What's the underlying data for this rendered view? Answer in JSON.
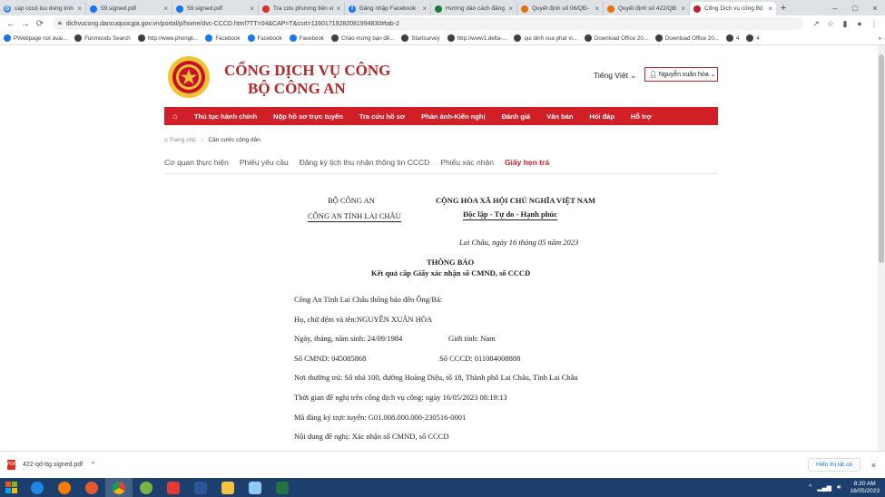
{
  "browser": {
    "tabs": [
      {
        "label": "cap cccd luu dong tinh",
        "favicon": "G",
        "color": "#4285f4"
      },
      {
        "label": "59.signed.pdf",
        "favicon": "",
        "color": "#1a73e8"
      },
      {
        "label": "59.signed.pdf",
        "favicon": "",
        "color": "#1a73e8"
      },
      {
        "label": "Tra cứu phương tiện vi",
        "favicon": "",
        "color": "#d93025"
      },
      {
        "label": "Đăng nhập Facebook",
        "favicon": "f",
        "color": "#1877f2"
      },
      {
        "label": "Hướng dẫn cách đăng",
        "favicon": "",
        "color": "#188038"
      },
      {
        "label": "Quyết định số 06/QĐ-",
        "favicon": "",
        "color": "#e8710a"
      },
      {
        "label": "Quyết định số 422/QĐ",
        "favicon": "",
        "color": "#e8710a"
      },
      {
        "label": "Cổng Dịch vụ công Bộ",
        "favicon": "",
        "color": "#b8252a"
      }
    ],
    "url": "dichvucong.dancuquocgia.gov.vn/portal/p/home/dvc-CCCD.html?TT=04&CAP=T&csrt=11601719282081994830#tab-2",
    "bookmarks": [
      "PWebpage not avai...",
      "Funmoods Search",
      "http://www.phongk...",
      "Facebook",
      "Facebook",
      "Facebook",
      "Chào mừng bạn đế...",
      "Startsurvey",
      "http://www1.delta-...",
      "qui dinh xua phat vi...",
      "Download Office 20...",
      "Download Office 20...",
      "4",
      "4"
    ]
  },
  "site": {
    "title": "CỔNG DỊCH VỤ CÔNG",
    "subtitle": "BỘ CÔNG AN",
    "language": "Tiếng Việt",
    "user": "Nguyễn xuân hòa",
    "nav": [
      "Thủ tục hành chính",
      "Nộp hồ sơ trực tuyến",
      "Tra cứu hồ sơ",
      "Phản ánh-Kiến nghị",
      "Đánh giá",
      "Văn bản",
      "Hỏi đáp",
      "Hỗ trợ"
    ],
    "breadcrumb": {
      "home": "Trang chủ",
      "current": "Căn cước công dân"
    },
    "page_tabs": [
      "Cơ quan thực hiện",
      "Phiếu yêu cầu",
      "Đăng ký lịch thu nhận thông tin CCCD",
      "Phiếu xác nhận",
      "Giấy hẹn trả"
    ],
    "active_tab": 4
  },
  "document": {
    "org_top": "BỘ CÔNG AN",
    "org_sub": "CÔNG AN TỈNH LAI CHÂU",
    "country": "CỘNG HÒA XÃ HỘI CHỦ NGHĨA VIỆT NAM",
    "motto": "Độc lập - Tự do - Hạnh phúc",
    "date_line": "Lai Châu, ngày 16 tháng 05 năm 2023",
    "heading": "THÔNG BÁO",
    "subheading": "Kết quả cấp Giấy xác nhận số CMND, số CCCD",
    "intro": "Công An Tỉnh Lai Châu thông báo đến Ông/Bà:",
    "name_line": "Họ, chữ đệm và tên:NGUYỄN XUÂN HÒA",
    "dob_line": "Ngày, tháng, năm sinh: 24/09/1984",
    "gender_line": "Giới tính: Nam",
    "cmnd_line": "Số CMND: 045085868",
    "cccd_line": "Số CCCD: 011084008888",
    "address_line": "Nơi thường trú: Số nhà 100, đường Hoàng Diệu, tổ 18, Thành phố Lai Châu, Tỉnh Lai Châu",
    "time_line": "Thời gian đề nghị trên cổng dịch vụ công: ngày 16/05/2023 08:19:13",
    "code_line": "Mã đăng ký trực tuyến: G01.008.000.000-230516-0001",
    "content_line": "Nội dung đề nghị: Xác nhận số CMND, số CCCD"
  },
  "downloads": {
    "file": "422-qd-ttg.signed.pdf",
    "show_all": "Hiển thị tất cả"
  },
  "taskbar": {
    "time": "8:20 AM",
    "date": "16/05/2023",
    "apps": [
      {
        "icon": "ie-icon",
        "color": "#1e88e5"
      },
      {
        "icon": "media-player-icon",
        "color": "#f57c00"
      },
      {
        "icon": "firefox-icon",
        "color": "#e55b2d"
      },
      {
        "icon": "chrome-icon",
        "color": "#34a853"
      },
      {
        "icon": "app-icon",
        "color": "#7cb342"
      },
      {
        "icon": "remote-icon",
        "color": "#e53935"
      },
      {
        "icon": "word-icon",
        "color": "#2b579a"
      },
      {
        "icon": "folder-icon",
        "color": "#f9c23c"
      },
      {
        "icon": "paint-icon",
        "color": "#90caf9"
      },
      {
        "icon": "excel-icon",
        "color": "#217346"
      }
    ]
  }
}
